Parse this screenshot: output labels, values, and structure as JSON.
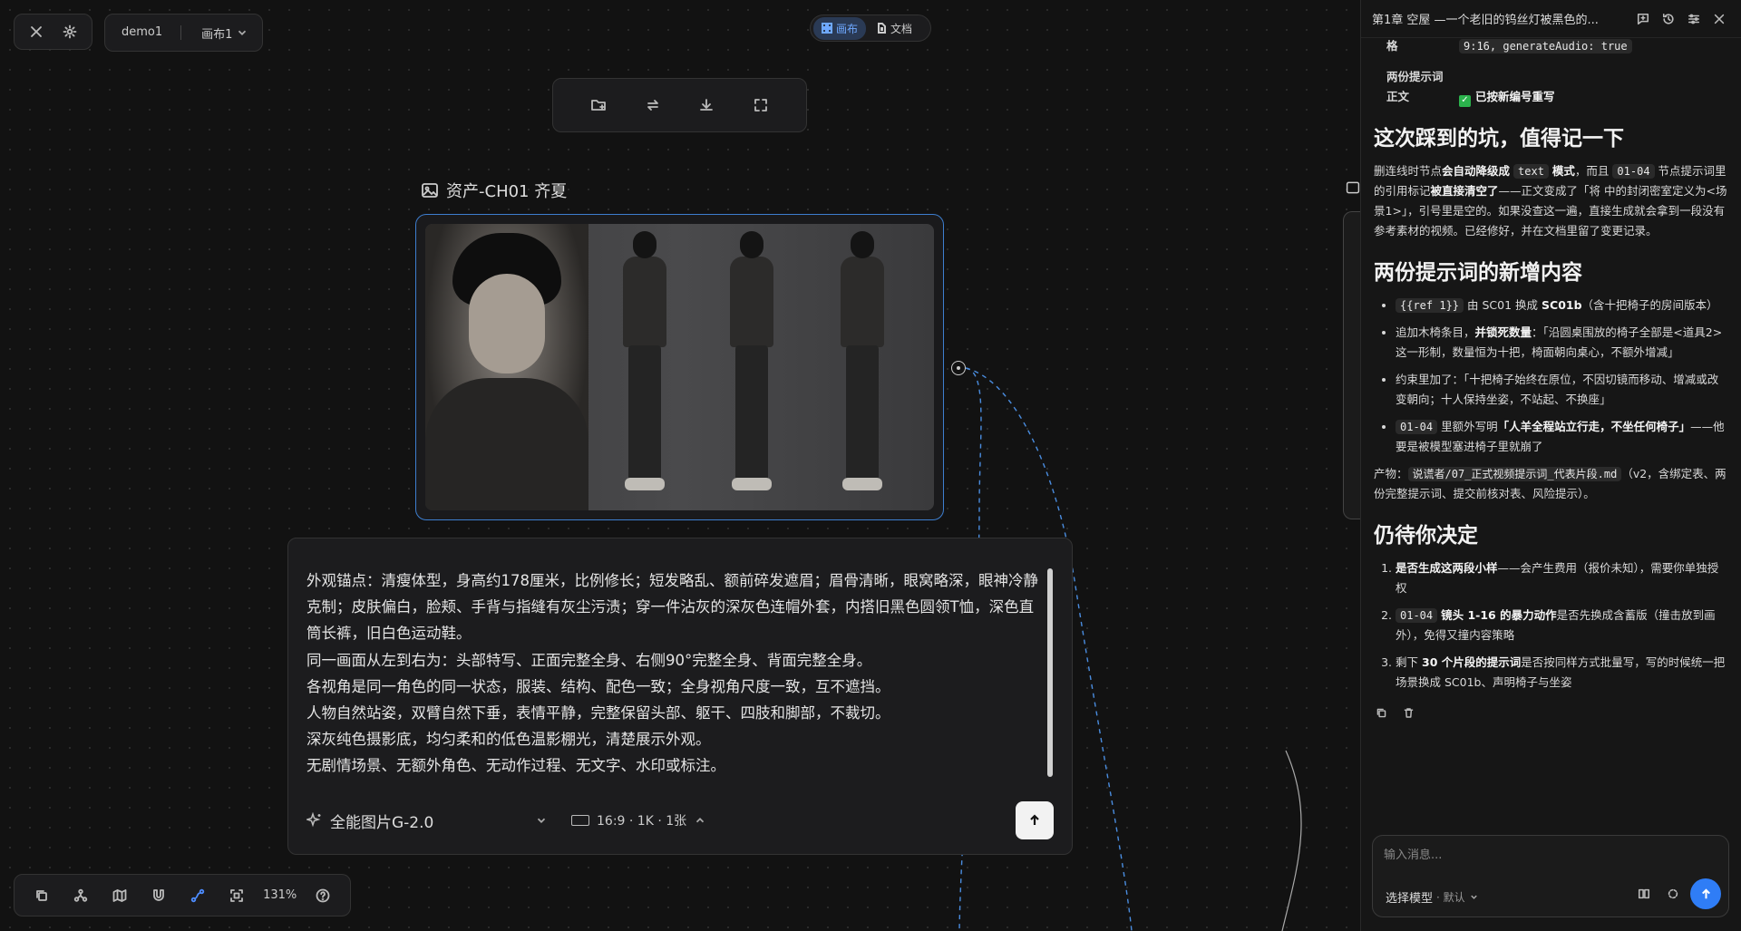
{
  "topbar": {
    "project": "demo1",
    "canvas": "画布1",
    "mode_canvas": "画布",
    "mode_docs": "文档"
  },
  "node": {
    "title": "资产-CH01 齐夏"
  },
  "prompt": {
    "text": "外观锚点：清瘦体型，身高约178厘米，比例修长；短发略乱、额前碎发遮眉；眉骨清晰，眼窝略深，眼神冷静克制；皮肤偏白，脸颊、手背与指缝有灰尘污渍；穿一件沾灰的深灰色连帽外套，内搭旧黑色圆领T恤，深色直筒长裤，旧白色运动鞋。\n同一画面从左到右为：头部特写、正面完整全身、右侧90°完整全身、背面完整全身。\n各视角是同一角色的同一状态，服装、结构、配色一致；全身视角尺度一致，互不遮挡。\n人物自然站姿，双臂自然下垂，表情平静，完整保留头部、躯干、四肢和脚部，不裁切。\n深灰纯色摄影底，均匀柔和的低色温影棚光，清楚展示外观。\n无剧情场景、无额外角色、无动作过程、无文字、水印或标注。",
    "model": "全能图片G-2.0",
    "ratio": "16:9 · 1K · 1张"
  },
  "bottombar": {
    "zoom": "131%"
  },
  "panel": {
    "title": "第1章 空屋 —一个老旧的钨丝灯被黑色的...",
    "row1_key": "格",
    "row1_value": "9:16, generateAudio: true",
    "row2_key": "两份提示词正文",
    "row2_value": "已按新编号重写",
    "h_pitfalls": "这次踩到的坑，值得记一下",
    "pitfalls_text_1": "删连线时节点",
    "pitfalls_bold_1": "会自动降级成",
    "pitfalls_code_1": "text",
    "pitfalls_bold_2": "模式",
    "pitfalls_text_2": "，而且",
    "pitfalls_code_2": "01-04",
    "pitfalls_text_3": "节点提示词里的引用标记",
    "pitfalls_bold_3": "被直接清空了",
    "pitfalls_text_4": "——正文变成了「将 中的封闭密室定义为<场景1>」，引号里是空的。如果没查这一遍，直接生成就会拿到一段没有参考素材的视频。已经修好，并在文档里留了变更记录。",
    "h_additions": "两份提示词的新增内容",
    "add1_code": "{{ref 1}}",
    "add1_text_a": "由 SC01 换成",
    "add1_bold": "SC01b",
    "add1_text_b": "（含十把椅子的房间版本）",
    "add2_text_a": "追加木椅条目，",
    "add2_bold": "并锁死数量",
    "add2_text_b": "：「沿圆桌围放的椅子全部是<道具2>这一形制，数量恒为十把，椅面朝向桌心，不额外增减」",
    "add3": "约束里加了：「十把椅子始终在原位，不因切镜而移动、增减或改变朝向；十人保持坐姿，不站起、不换座」",
    "add4_code": "01-04",
    "add4_text_a": "里额外写明",
    "add4_bold": "「人羊全程站立行走，不坐任何椅子」",
    "add4_text_b": "——他要是被模型塞进椅子里就崩了",
    "output_label": "产物：",
    "output_code": "说谎者/07_正式视频提示词_代表片段.md",
    "output_text": "（v2，含绑定表、两份完整提示词、提交前核对表、风险提示）。",
    "h_pending": "仍待你决定",
    "pend1_bold": "是否生成这两段小样",
    "pend1_text": "——会产生费用（报价未知），需要你单独授权",
    "pend2_code": "01-04",
    "pend2_bold": "镜头 1-16 的暴力动作",
    "pend2_text": "是否先换成含蓄版（撞击放到画外），免得又撞内容策略",
    "pend3_text_a": "剩下",
    "pend3_bold_a": "30 个片段的提示词",
    "pend3_text_b": "是否按同样方式批量写，写的时候统一把场景换成 SC01b、声明椅子与坐姿",
    "chat_placeholder": "输入消息...",
    "model_label": "选择模型",
    "model_default": "· 默认"
  }
}
